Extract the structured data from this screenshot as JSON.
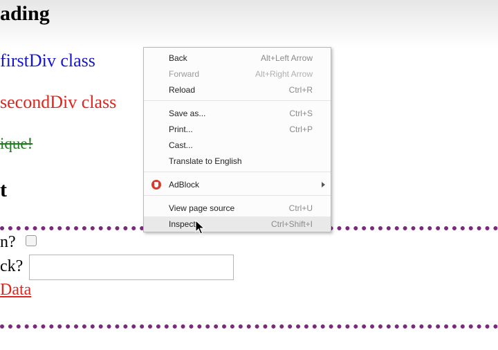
{
  "page": {
    "heading": "ading",
    "first_div": "firstDiv class",
    "second_div": "secondDiv class",
    "unique_text": "ique!",
    "section_heading": "t",
    "question_1": "n?",
    "question_2": "ck?",
    "input_value": "",
    "link_text": "Data"
  },
  "context_menu": {
    "items": [
      {
        "label": "Back",
        "shortcut": "Alt+Left Arrow"
      },
      {
        "label": "Forward",
        "shortcut": "Alt+Right Arrow",
        "disabled": true
      },
      {
        "label": "Reload",
        "shortcut": "Ctrl+R"
      },
      {
        "label": "Save as...",
        "shortcut": "Ctrl+S"
      },
      {
        "label": "Print...",
        "shortcut": "Ctrl+P"
      },
      {
        "label": "Cast...",
        "shortcut": ""
      },
      {
        "label": "Translate to English",
        "shortcut": ""
      },
      {
        "label": "AdBlock",
        "shortcut": "",
        "icon": "adblock-icon",
        "submenu": true
      },
      {
        "label": "View page source",
        "shortcut": "Ctrl+U"
      },
      {
        "label": "Inspect",
        "shortcut": "Ctrl+Shift+I",
        "hovered": true
      }
    ]
  },
  "colors": {
    "first_div": "#1414d6",
    "second_div": "#e0251e",
    "unique": "#1f7a1f",
    "dotted_border": "#7a2a7a",
    "link": "#e0251e"
  }
}
